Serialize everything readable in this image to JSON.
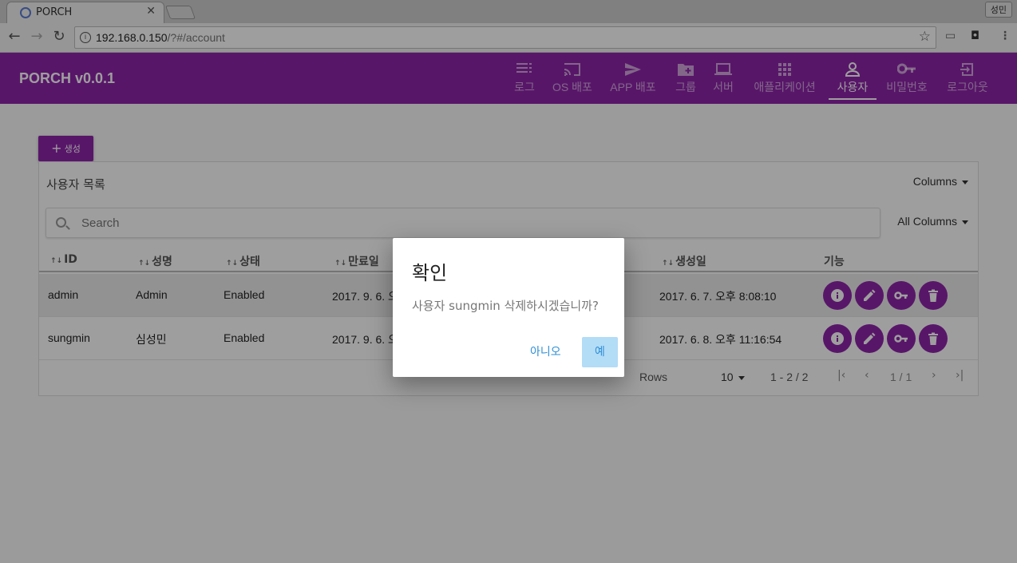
{
  "browser": {
    "tab_title": "PORCH",
    "tab_close": "✕",
    "profile": "성민",
    "url_host": "192.168.0.150",
    "url_path": "/?#/account"
  },
  "app": {
    "brand": "PORCH v0.0.1",
    "nav": [
      {
        "label": "로그",
        "icon": "list-icon"
      },
      {
        "label": "OS 배포",
        "icon": "cast-icon"
      },
      {
        "label": "APP 배포",
        "icon": "send-icon"
      },
      {
        "label": "그룹",
        "icon": "folder-add-icon"
      },
      {
        "label": "서버",
        "icon": "laptop-icon"
      },
      {
        "label": "애플리케이션",
        "icon": "apps-grid-icon"
      },
      {
        "label": "사용자",
        "icon": "person-icon",
        "active": true
      },
      {
        "label": "비밀번호",
        "icon": "key-icon"
      },
      {
        "label": "로그아웃",
        "icon": "logout-icon"
      }
    ]
  },
  "page": {
    "create_label": "생성",
    "panel_title": "사용자 목록",
    "columns_label": "Columns",
    "search_placeholder": "Search",
    "all_columns_label": "All Columns",
    "headers": [
      "ID",
      "성명",
      "상태",
      "만료일",
      "생성일",
      "기능"
    ],
    "rows": [
      {
        "id": "admin",
        "name": "Admin",
        "status": "Enabled",
        "expires": "2017. 9. 6. 오",
        "created": "2017. 6. 7. 오후 8:08:10"
      },
      {
        "id": "sungmin",
        "name": "심성민",
        "status": "Enabled",
        "expires": "2017. 9. 6. 오",
        "created": "2017. 6. 8. 오후 11:16:54"
      }
    ],
    "pager": {
      "rows_label": "Rows",
      "rows_value": "10",
      "range": "1 - 2 / 2",
      "page": "1 / 1"
    }
  },
  "dialog": {
    "title": "확인",
    "message": "사용자 sungmin 삭제하시겠습니까?",
    "no_label": "아니오",
    "yes_label": "예"
  },
  "colors": {
    "primary": "#8e24aa",
    "dialog_accent": "#2f8fd6",
    "dialog_yes_bg": "#b3dcf7"
  }
}
